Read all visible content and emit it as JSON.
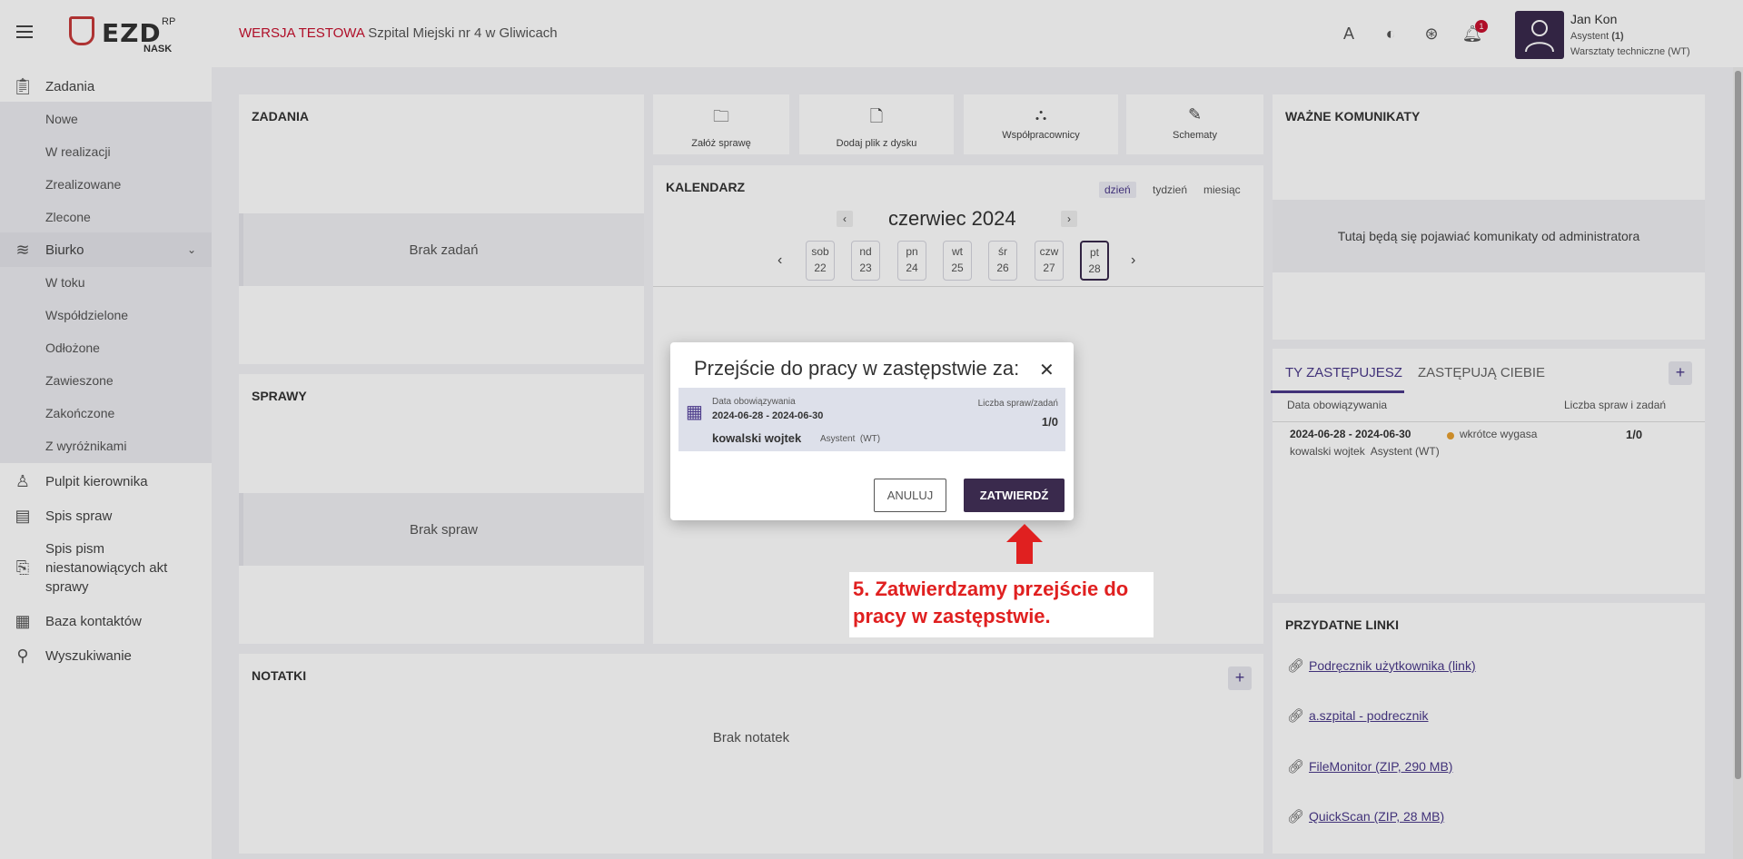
{
  "header": {
    "logo_text": "EZD",
    "logo_sup": "RP",
    "logo_sub": "NASK",
    "test_label": "WERSJA TESTOWA",
    "org_name": "Szpital Miejski nr 4 w Gliwicach",
    "notif_count": "1",
    "user": {
      "name": "Jan Kon",
      "role_prefix": "Asystent ",
      "role_count": "(1)",
      "dept": "Warsztaty techniczne (WT)"
    }
  },
  "sidebar": {
    "zadania": "Zadania",
    "zadania_items": [
      "Nowe",
      "W realizacji",
      "Zrealizowane",
      "Zlecone"
    ],
    "biurko": "Biurko",
    "biurko_items": [
      "W toku",
      "Współdzielone",
      "Odłożone",
      "Zawieszone",
      "Zakończone",
      "Z wyróżnikami"
    ],
    "pulpit": "Pulpit kierownika",
    "spis_spraw": "Spis spraw",
    "spis_pism": "Spis pism niestanowiących akt sprawy",
    "baza": "Baza kontaktów",
    "wyszukiwanie": "Wyszukiwanie"
  },
  "panels": {
    "zadania": {
      "title": "ZADANIA",
      "empty": "Brak zadań"
    },
    "sprawy": {
      "title": "SPRAWY",
      "empty": "Brak spraw"
    },
    "notatki": {
      "title": "NOTATKI",
      "empty": "Brak notatek"
    },
    "komunikaty": {
      "title": "WAŻNE KOMUNIKATY",
      "empty": "Tutaj będą się pojawiać komunikaty od administratora"
    },
    "linki": {
      "title": "PRZYDATNE LINKI",
      "items": [
        "Podręcznik użytkownika (link)",
        "a.szpital - podrecznik",
        "FileMonitor (ZIP, 290 MB)",
        "QuickScan (ZIP, 28 MB)"
      ]
    }
  },
  "quick_actions": [
    "Załóż sprawę",
    "Dodaj plik z dysku",
    "Współpracownicy",
    "Schematy"
  ],
  "calendar": {
    "title": "KALENDARZ",
    "views": [
      "dzień",
      "tydzień",
      "miesiąc"
    ],
    "month": "czerwiec 2024",
    "days": [
      {
        "name": "sob",
        "num": "22"
      },
      {
        "name": "nd",
        "num": "23"
      },
      {
        "name": "pn",
        "num": "24"
      },
      {
        "name": "wt",
        "num": "25"
      },
      {
        "name": "śr",
        "num": "26"
      },
      {
        "name": "czw",
        "num": "27"
      },
      {
        "name": "pt",
        "num": "28"
      }
    ]
  },
  "substitution": {
    "tab_active": "TY ZASTĘPUJESZ",
    "tab_other": "ZASTĘPUJĄ CIEBIE",
    "col_date": "Data obowiązywania",
    "col_count": "Liczba spraw i zadań",
    "row_dates": "2024-06-28 - 2024-06-30",
    "row_status": "wkrótce wygasa",
    "row_person": "kowalski wojtek  Asystent (WT)",
    "row_count": "1/0"
  },
  "modal": {
    "title": "Przejście do pracy w zastępstwie za:",
    "date_label": "Data obowiązywania",
    "dates": "2024-06-28 - 2024-06-30",
    "count_label": "Liczba spraw/zadań",
    "count": "1/0",
    "person": "kowalski wojtek",
    "role": "Asystent  (WT)",
    "cancel": "ANULUJ",
    "confirm": "ZATWIERDŹ"
  },
  "annotation": {
    "line1": "5. Zatwierdzamy przejście do",
    "line2": "pracy w zastępstwie."
  },
  "colors": {
    "accent": "#3a2a4d",
    "link": "#4b3a8a",
    "test": "#c8102e",
    "annotation": "#e02020"
  }
}
